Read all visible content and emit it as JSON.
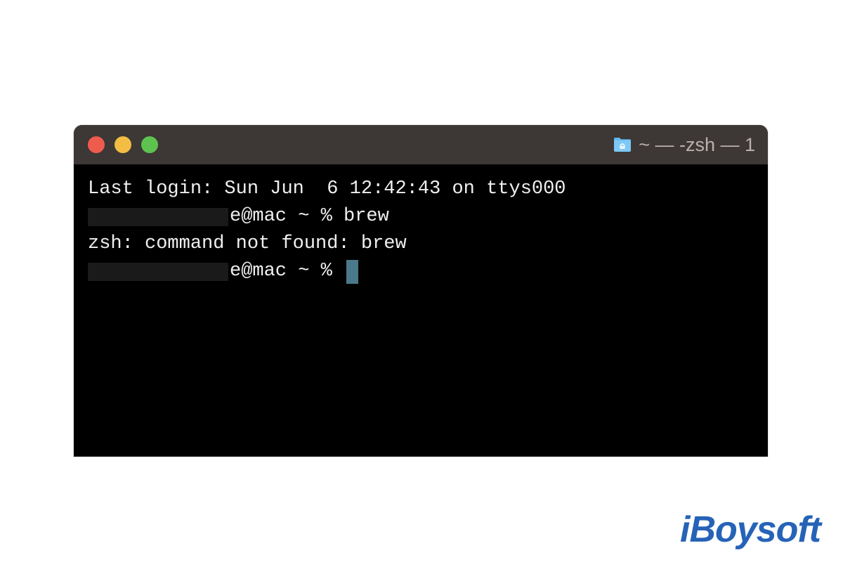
{
  "window": {
    "title": "~ — -zsh — 1"
  },
  "terminal": {
    "line1": "Last login: Sun Jun  6 12:42:43 on ttys000",
    "line2_prompt_suffix": "e@mac ~ % ",
    "line2_command": "brew",
    "line3": "zsh: command not found: brew",
    "line4_prompt_suffix": "e@mac ~ % "
  },
  "watermark": {
    "text": "iBoysoft"
  }
}
